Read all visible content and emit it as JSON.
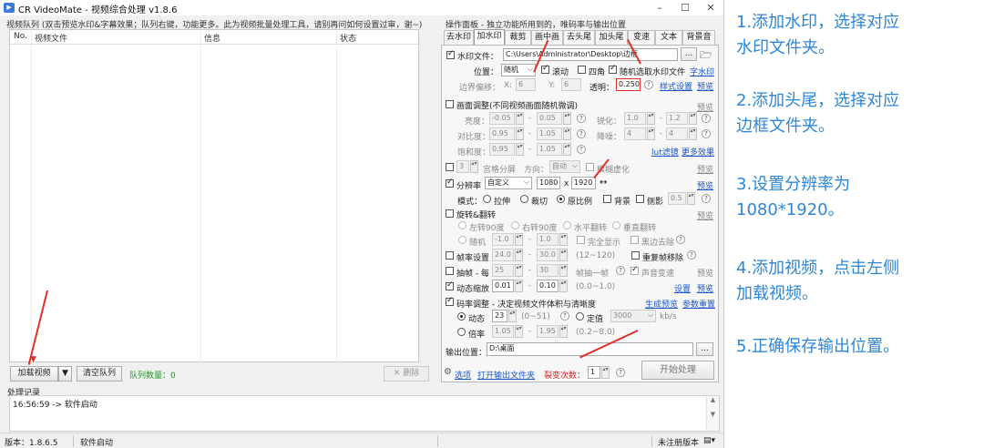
{
  "window": {
    "title": "CR VideoMate - 视频综合处理 v1.8.6",
    "controls": [
      "–",
      "☐",
      "✕"
    ]
  },
  "queue": {
    "header": "视频队列 (双击预览水印&字幕效果；队列右键，功能更多。此为视频批量处理工具，请别再问如何设置过审，谢~)",
    "columns": [
      "No.",
      "视频文件",
      "信息",
      "状态"
    ],
    "add_button": "加载视频",
    "add_dropdown": "▼",
    "clear_button": "清空队列",
    "count": "队列数量：0",
    "delete_button": "✕ 删除"
  },
  "panel": {
    "header": "操作面板 - 独立功能所用到的，唯码率与输出位置",
    "tabs": [
      "去水印",
      "加水印",
      "裁剪",
      "画中画",
      "去头尾",
      "加头尾",
      "变速",
      "文本",
      "背景音"
    ],
    "active_tab": "加水印",
    "watermark": {
      "file_label": "水印文件：",
      "file_path": "C:\\Users\\Administrator\\Desktop\\边框",
      "browse": "...",
      "folder_icon": "folder-open-icon",
      "position_label": "位置：",
      "position_value": "随机",
      "scroll": "滚动",
      "corners": "四角",
      "random_pick": "随机选取水印文件",
      "subtitle_link": "字水印",
      "margin_label": "边界偏移：",
      "x_label": "X:",
      "x_value": "6",
      "y_label": "Y:",
      "y_value": "6",
      "opacity_label": "透明：",
      "opacity_value": "0.250",
      "style_link": "样式设置",
      "preview_link": "预览"
    },
    "adjust": {
      "title": "画面调整(不同视频画面随机微调)",
      "preview": "预览",
      "brightness": "亮度：",
      "b_min": "-0.05",
      "b_max": "0.05",
      "sharpen": "锐化：",
      "s_min": "1.0",
      "s_max": "1.2",
      "contrast": "对比度：",
      "c_min": "0.95",
      "c_max": "1.05",
      "denoise": "降噪：",
      "d_min": "4",
      "d_max": "4",
      "saturation": "饱和度：",
      "sa_min": "0.95",
      "sa_max": "1.05",
      "lut_link": "lut滤镜",
      "more_link": "更多效果"
    },
    "split": {
      "count": "3",
      "label": "宫格分屏",
      "dir_label": "方向：",
      "dir_value": "自动",
      "blur": "模糊虚化",
      "preview": "预览"
    },
    "resolution": {
      "label": "分辨率",
      "mode": "自定义",
      "width": "1080",
      "x": "x",
      "height": "1920",
      "swap": "↔",
      "preview": "预览",
      "mode_label": "模式：",
      "stretch": "拉伸",
      "crop": "裁切",
      "ratio": "原比例",
      "background": "背景",
      "side_shadow": "侧影",
      "side_value": "0.5"
    },
    "rotate": {
      "title": "旋转&翻转",
      "preview": "预览",
      "left90": "左转90度",
      "right90": "右转90度",
      "hflip": "水平翻转",
      "vflip": "垂直翻转",
      "random": "随机",
      "r_min": "-1.0",
      "r_max": "1.0",
      "full": "完全显示",
      "black_border": "黑边去除"
    },
    "framerate": {
      "label": "帧率设置",
      "min": "24.0",
      "max": "30.0",
      "hint": "(12~120)",
      "dedupe": "重复帧移除"
    },
    "drop": {
      "label": "抽帧 - 每",
      "a": "25",
      "b": "30",
      "unit": "帧抽一帧",
      "audio_speed": "声音变速",
      "preview": "预览"
    },
    "zoom": {
      "label": "动态缩放",
      "min": "0.01",
      "max": "0.10",
      "hint": "(0.0~1.0)",
      "settings": "设置",
      "preview": "预览"
    },
    "bitrate": {
      "title": "码率调整 - 决定视频文件体积与清晰度",
      "build_link": "生成预览",
      "reset_link": "参数重置",
      "dynamic": "动态",
      "dynamic_value": "23",
      "dynamic_hint": "(0~51)",
      "fixed": "定值",
      "fixed_value": "3000",
      "unit": "kb/s",
      "multiple": "倍率",
      "m_min": "1.05",
      "m_max": "1.95",
      "m_hint": "(0.2~8.0)"
    },
    "output": {
      "label": "输出位置：",
      "path": "D:\\桌面",
      "browse": "..."
    },
    "footer": {
      "options": "选项",
      "open_folder": "打开输出文件夹",
      "copies_label": "裂变次数：",
      "copies": "1",
      "start": "开始处理"
    }
  },
  "log": {
    "label": "处理记录",
    "lines": [
      "16:56:59 -> 软件启动"
    ]
  },
  "statusbar": {
    "version": "版本：1.8.6.5",
    "status": "软件启动",
    "license": "未注册版本"
  },
  "instructions": [
    "1.添加水印，选择对应",
    "水印文件夹。",
    "2.添加头尾，选择对应",
    "边框文件夹。",
    "3.设置分辨率为",
    "1080*1920。",
    "4.添加视频，点击左侧",
    "加载视频。",
    "5.正确保存输出位置。"
  ],
  "colors": {
    "instruction_text": "#2e86d6",
    "annotation_arrow": "#e0302a",
    "link": "#1a55c7",
    "count_text": "#1b9a1b",
    "copies_label": "#d81e1e"
  }
}
